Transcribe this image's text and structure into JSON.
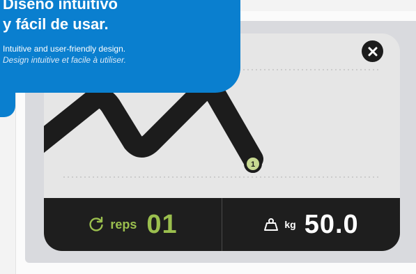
{
  "promo": {
    "title_line1": "Diseño intuitivo",
    "title_line2": "y fácil de usar.",
    "subtitle_en": "Intuitive and user-friendly design.",
    "subtitle_fr": "Design intuitive et facile à utiliser."
  },
  "workout": {
    "reps_label": "reps",
    "reps_value": "01",
    "weight_unit": "kg",
    "weight_value": "50.0",
    "marker_number": "1"
  },
  "icons": {
    "close": "close-icon",
    "repeat": "repeat-icon",
    "weight": "weight-icon"
  },
  "colors": {
    "brand_blue": "#0a7fcf",
    "accent_green": "#9bbf4e",
    "dark_panel": "#1e1e1e",
    "screen_bg": "#e6e6e6"
  }
}
